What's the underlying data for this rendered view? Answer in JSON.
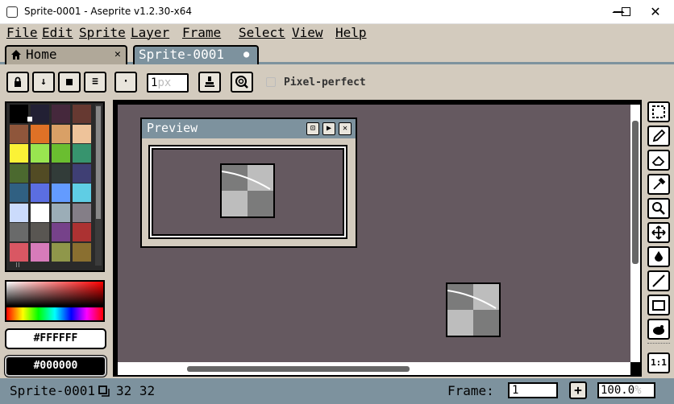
{
  "window": {
    "title": "Sprite-0001 - Aseprite v1.2.30-x64",
    "minimize": "—",
    "maximize": "☐",
    "close": "✕"
  },
  "menu": [
    "File",
    "Edit",
    "Sprite",
    "Layer",
    "Frame",
    "Select",
    "View",
    "Help"
  ],
  "tabs": [
    {
      "label": "Home",
      "close": "✕"
    },
    {
      "label": "Sprite-0001",
      "modified": "●"
    }
  ],
  "toolbar": {
    "brush_size": "1",
    "brush_unit": "px",
    "pixel_perfect_label": "Pixel-perfect",
    "pixel_perfect_checked": false
  },
  "palette": {
    "colors": [
      "#000000",
      "#222034",
      "#45283c",
      "#663931",
      "#8f563b",
      "#df7126",
      "#d9a066",
      "#eec39a",
      "#fbf236",
      "#99e550",
      "#6abe30",
      "#37946e",
      "#4b692f",
      "#524b24",
      "#323c39",
      "#3f3f74",
      "#306082",
      "#5b6ee1",
      "#639bff",
      "#5fcde4",
      "#cbdbfc",
      "#ffffff",
      "#9badb7",
      "#847e87",
      "#696a6a",
      "#595652",
      "#76428a",
      "#ac3232",
      "#d95763",
      "#d77bba",
      "#8f974a",
      "#8a6f30"
    ]
  },
  "colors": {
    "foreground": "#FFFFFF",
    "background": "#000000"
  },
  "preview": {
    "title": "Preview"
  },
  "status": {
    "sprite_name": "Sprite-0001",
    "size": "32 32",
    "frame_label": "Frame:",
    "frame_value": "1",
    "add_frame": "+",
    "zoom": "100.0",
    "zoom_unit": "%"
  },
  "tools": [
    "rectangular-marquee",
    "pencil",
    "eraser",
    "eyedropper",
    "zoom",
    "move",
    "paint-bucket",
    "line",
    "rectangle",
    "blur",
    "one-to-one"
  ]
}
